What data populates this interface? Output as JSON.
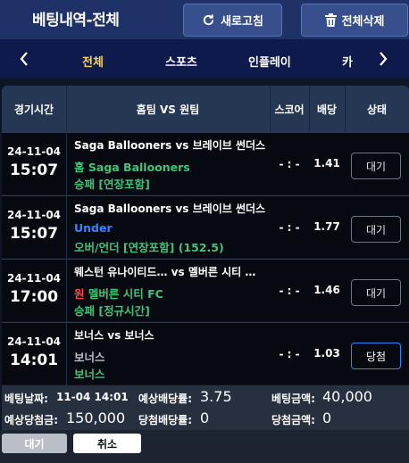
{
  "header": {
    "title": "베팅내역-전체",
    "refresh_label": "새로고침",
    "delete_all_label": "전체삭제"
  },
  "tabs": [
    {
      "label": "전체",
      "active": true
    },
    {
      "label": "스포츠",
      "active": false
    },
    {
      "label": "인플레이",
      "active": false
    },
    {
      "label": "카",
      "active": false
    }
  ],
  "table": {
    "columns": [
      "경기시간",
      "홈팀 VS 원팀",
      "스코어",
      "배당",
      "상태"
    ],
    "rows": [
      {
        "date": "24-11-04",
        "time": "15:07",
        "match": "Saga Ballooners vs 브레이브 썬더스",
        "pick_prefix": "홈",
        "pick": "Saga Ballooners",
        "market": "승패 [연장포함]",
        "score": "- : -",
        "odds": "1.41",
        "status": "대기"
      },
      {
        "date": "24-11-04",
        "time": "15:07",
        "match": "Saga Ballooners vs 브레이브 썬더스",
        "pick_prefix": "",
        "pick": "Under",
        "market": "오버/언더 [연장포함] (152.5)",
        "score": "- : -",
        "odds": "1.77",
        "status": "대기"
      },
      {
        "date": "24-11-04",
        "time": "17:00",
        "match": "웨스턴 유나이티드… vs 멜버른 시티 …",
        "pick_prefix": "원",
        "pick": "멜버른 시티 FC",
        "market": "승패 [정규시간]",
        "score": "- : -",
        "odds": "1.46",
        "status": "대기"
      },
      {
        "date": "24-11-04",
        "time": "14:01",
        "match": "보너스 vs 보너스",
        "pick_prefix": "",
        "pick": "보너스",
        "market": "보너스",
        "score": "- : -",
        "odds": "1.03",
        "status": "당첨"
      }
    ]
  },
  "summary": {
    "bet_date_label": "베팅날짜:",
    "bet_date": "11-04 14:01",
    "expected_odds_label": "예상배당률:",
    "expected_odds": "3.75",
    "bet_amount_label": "베팅금액:",
    "bet_amount": "40,000",
    "expected_win_label": "예상당첨금:",
    "expected_win": "150,000",
    "win_odds_label": "당첨배당률:",
    "win_odds": "0",
    "win_amount_label": "당첨금액:",
    "win_amount": "0"
  },
  "buttons": {
    "wait_label": "대기",
    "cancel_label": "취소"
  },
  "colors": {
    "header_bg": "#1e3268",
    "tabs_bg": "#0f1a4c",
    "active_tab": "#ffd24a",
    "home_pick": "#40c47a",
    "under_pick": "#2f86ff",
    "away_prefix": "#ff4343",
    "win_border": "#2e86ff"
  },
  "icons": [
    "refresh-icon",
    "trash-icon",
    "chevron-left-icon",
    "chevron-right-icon"
  ]
}
